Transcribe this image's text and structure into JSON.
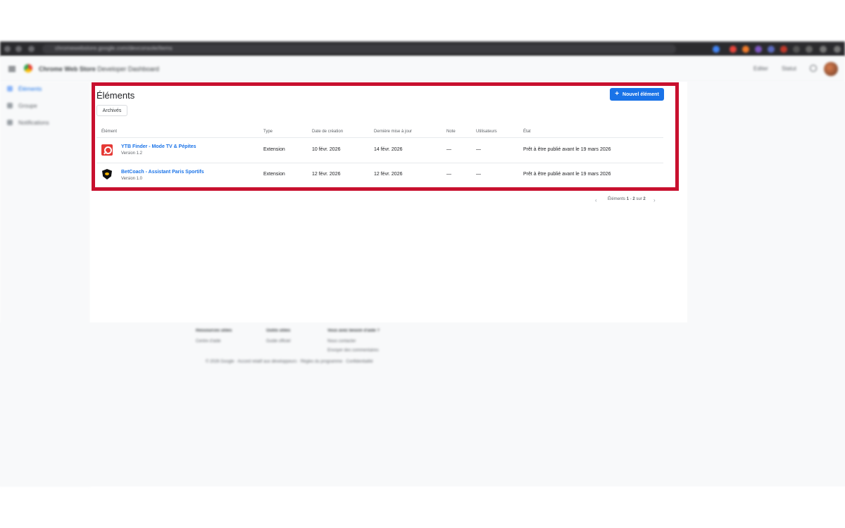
{
  "browser": {
    "url": "chromewebstore.google.com/devconsole/items"
  },
  "header": {
    "app_name": "Chrome Web Store",
    "app_subtitle": "Developer Dashboard",
    "right_link_1": "Editer",
    "right_link_2": "Statut"
  },
  "sidebar": {
    "items": [
      {
        "label": "Éléments",
        "active": true
      },
      {
        "label": "Groupe",
        "active": false
      },
      {
        "label": "Notifications",
        "active": false
      }
    ]
  },
  "main": {
    "title": "Éléments",
    "archives_button": "Archivés",
    "new_item_button": "Nouvel élément",
    "columns": [
      "Élément",
      "Type",
      "Date de création",
      "Dernière mise à jour",
      "Note",
      "Utilisateurs",
      "État"
    ],
    "rows": [
      {
        "name": "YTB Finder - Mode TV & Pépites",
        "version": "Version 1.2",
        "type": "Extension",
        "created": "10 févr. 2026",
        "updated": "14 févr. 2026",
        "rating": "—",
        "users": "—",
        "status": "Prêt à être publié avant le 19 mars 2026",
        "icon": "ytb-finder-icon"
      },
      {
        "name": "BetCoach - Assistant Paris Sportifs",
        "version": "Version 1.0",
        "type": "Extension",
        "created": "12 févr. 2026",
        "updated": "12 févr. 2026",
        "rating": "—",
        "users": "—",
        "status": "Prêt à être publié avant le 19 mars 2026",
        "icon": "betcoach-icon"
      }
    ],
    "pagination": {
      "prefix": "Éléments",
      "range_start": "1",
      "range_sep": " - ",
      "range_end": "2",
      "of": " sur ",
      "total": "2"
    }
  },
  "footer": {
    "col1_title": "Ressources utiles",
    "col1_link": "Centre d'aide",
    "col2_title": "Outils utiles",
    "col2_link": "Guide officiel",
    "col3_title": "Vous avez besoin d'aide ?",
    "col3_link1": "Nous contacter",
    "col3_link2": "Envoyer des commentaires",
    "legal": "© 2026 Google · Accord relatif aux développeurs · Règles du programme · Confidentialité"
  },
  "colors": {
    "accent": "#1a73e8",
    "highlight": "#c8102e"
  }
}
